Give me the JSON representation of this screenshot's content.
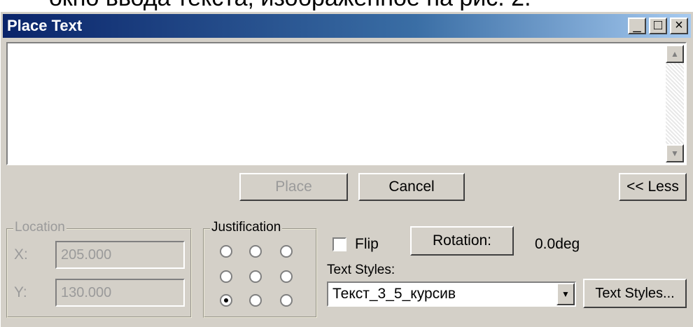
{
  "caption": "окно ввода текста, изображенное на рис. 2.",
  "window": {
    "title": "Place Text",
    "buttons": {
      "minimize": "_",
      "maximize": "□",
      "close": "×"
    }
  },
  "textarea": {
    "value": "",
    "scroll_up": "▲",
    "scroll_down": "▼"
  },
  "actions": {
    "place": "Place",
    "cancel": "Cancel",
    "less": "<< Less"
  },
  "location": {
    "legend": "Location",
    "x_label": "X:",
    "x_value": "205.000",
    "y_label": "Y:",
    "y_value": "130.000"
  },
  "justification": {
    "legend": "Justification",
    "selected": "bottom-left"
  },
  "flip": {
    "label": "Flip",
    "checked": false
  },
  "rotation": {
    "button": "Rotation:",
    "value": "0.0deg"
  },
  "text_styles": {
    "label": "Text Styles:",
    "selected": "Текст_3_5_курсив",
    "dropdown_arrow": "▼",
    "button": "Text Styles..."
  },
  "colors": {
    "face": "#d4d0c8",
    "title_start": "#0a246a",
    "title_end": "#a6caf0",
    "disabled_text": "#9a9a9a"
  }
}
